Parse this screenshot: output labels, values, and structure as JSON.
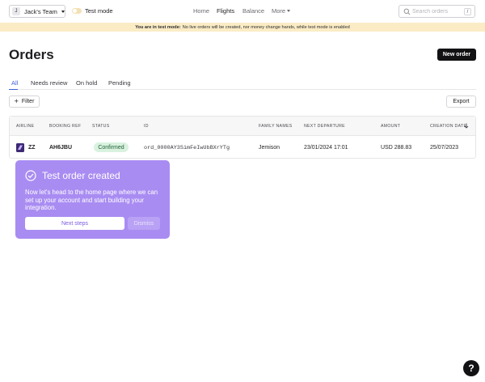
{
  "topnav": {
    "team_avatar_letter": "J",
    "team_name": "Jack's Team",
    "test_mode_label": "Test mode",
    "links": [
      "Home",
      "Flights",
      "Balance",
      "More"
    ],
    "active_link": "Flights",
    "search_placeholder": "Search orders",
    "search_shortcut": "/"
  },
  "banner": {
    "bold_text": "You are in test mode:",
    "text": "No live orders will be created, nor money change hands, while test mode is enabled"
  },
  "page": {
    "title": "Orders",
    "new_order_label": "New order"
  },
  "tabs": [
    "All",
    "Needs review",
    "On hold",
    "Pending"
  ],
  "active_tab": "All",
  "toolbar": {
    "filter_label": "Filter",
    "export_label": "Export"
  },
  "table": {
    "headers": [
      "AIRLINE",
      "BOOKING REF",
      "STATUS",
      "ID",
      "FAMILY NAMES",
      "NEXT DEPARTURE",
      "AMOUNT",
      "CREATION DATE"
    ],
    "sort_column": "CREATION DATE",
    "rows": [
      {
        "airline": "ZZ",
        "booking_ref": "AH6JBU",
        "status": "Confirmed",
        "id": "ord_0000AY3SimFeIwUbBXrYTg",
        "family_names": "Jemison",
        "next_departure": "23/01/2024 17:01",
        "amount": "USD 288.83",
        "creation_date": "25/07/2023"
      }
    ]
  },
  "popover": {
    "title": "Test order created",
    "body": "Now let's head to the home page where we can set up your account and start building your integration.",
    "next_label": "Next steps",
    "dismiss_label": "Dismiss"
  },
  "help": {
    "label": "?"
  },
  "colors": {
    "accent": "#3b63d9",
    "banner": "#fbecc5",
    "popover": "#a98cf2",
    "status_confirmed_bg": "#d9f2e0",
    "primary_button": "#121214"
  }
}
